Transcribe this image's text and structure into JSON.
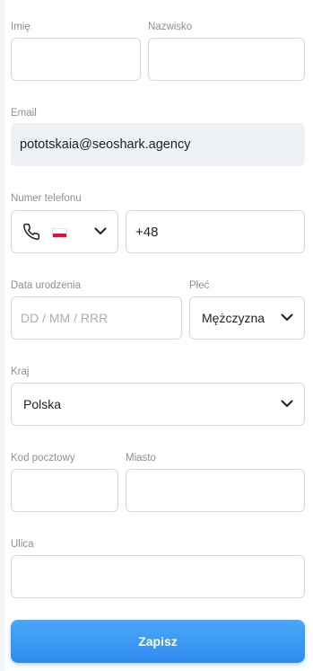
{
  "form": {
    "first_name": {
      "label": "Imię",
      "value": ""
    },
    "last_name": {
      "label": "Nazwisko",
      "value": ""
    },
    "email": {
      "label": "Email",
      "value": "pototskaia@seoshark.agency"
    },
    "phone": {
      "label": "Numer telefonu",
      "country_flag": "poland-flag-icon",
      "prefix": "+48"
    },
    "birth_date": {
      "label": "Data urodzenia",
      "placeholder": "DD / MM / RRR"
    },
    "gender": {
      "label": "Płeć",
      "selected": "Mężczyzna"
    },
    "country": {
      "label": "Kraj",
      "selected": "Polska"
    },
    "postal_code": {
      "label": "Kod pocztowy",
      "value": ""
    },
    "city": {
      "label": "Miasto",
      "value": ""
    },
    "street": {
      "label": "Ulica",
      "value": ""
    },
    "submit_label": "Zapisz"
  },
  "colors": {
    "accent": "#2f8cf0",
    "border": "#d3d7de",
    "readonly_bg": "#eef2f7",
    "label": "#8a8f98"
  }
}
